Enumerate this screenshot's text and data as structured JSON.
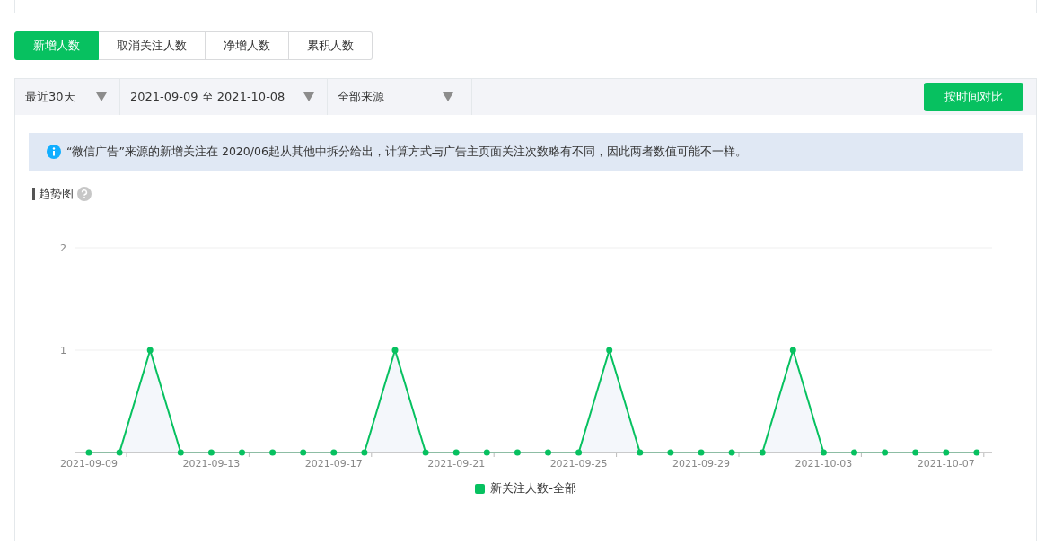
{
  "tabs": [
    {
      "label": "新增人数",
      "selected": true
    },
    {
      "label": "取消关注人数",
      "selected": false
    },
    {
      "label": "净增人数",
      "selected": false
    },
    {
      "label": "累积人数",
      "selected": false
    }
  ],
  "filters": [
    {
      "label": "最近30天"
    },
    {
      "label": "2021-09-09 至 2021-10-08"
    },
    {
      "label": "全部来源"
    }
  ],
  "compare_button": "按时间对比",
  "notice": "“微信广告”来源的新增关注在 2020/06起从其他中拆分给出，计算方式与广告主页面关注次数略有不同，因此两者数值可能不一样。",
  "chart_title": "趋势图",
  "chart_data": {
    "type": "line",
    "categories": [
      "2021-09-09",
      null,
      null,
      null,
      "2021-09-13",
      null,
      null,
      null,
      "2021-09-17",
      null,
      null,
      null,
      "2021-09-21",
      null,
      null,
      null,
      "2021-09-25",
      null,
      null,
      null,
      "2021-09-29",
      null,
      null,
      null,
      "2021-10-03",
      null,
      null,
      null,
      "2021-10-07",
      null
    ],
    "series": [
      {
        "name": "新关注人数-全部",
        "color": "#07c160",
        "marker": "circle",
        "values": [
          0,
          0,
          1,
          0,
          0,
          0,
          0,
          0,
          0,
          0,
          1,
          0,
          0,
          0,
          0,
          0,
          0,
          1,
          0,
          0,
          0,
          0,
          0,
          1,
          0,
          0,
          0,
          0,
          0,
          0
        ]
      }
    ],
    "ylim": [
      0,
      2
    ],
    "yticks": [
      1,
      2
    ]
  }
}
